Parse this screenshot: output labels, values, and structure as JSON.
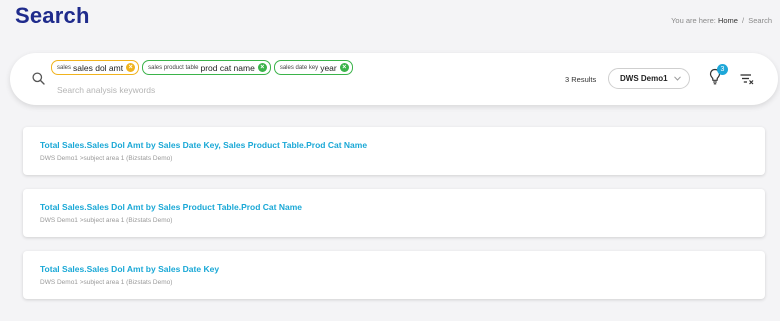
{
  "page": {
    "title": "Search"
  },
  "breadcrumb": {
    "prefix": "You are here:",
    "home": "Home",
    "separator": "/",
    "current": "Search"
  },
  "search": {
    "placeholder": "Search analysis keywords",
    "chips": [
      {
        "prefix": "sales",
        "main": "sales dol amt",
        "color": "#f0b31e"
      },
      {
        "prefix": "sales product table",
        "main": "prod cat name",
        "color": "#3bb34a"
      },
      {
        "prefix": "sales date key",
        "main": "year",
        "color": "#3bb34a"
      }
    ],
    "results_count": "3 Results",
    "dataset": "DWS Demo1",
    "suggestions_badge": "3"
  },
  "results": [
    {
      "title": "Total Sales.Sales Dol Amt by Sales Date Key, Sales Product Table.Prod Cat Name",
      "subtitle": "DWS Demo1 >subject area 1 (Bizstats Demo)"
    },
    {
      "title": "Total Sales.Sales Dol Amt by Sales Product Table.Prod Cat Name",
      "subtitle": "DWS Demo1 >subject area 1 (Bizstats Demo)"
    },
    {
      "title": "Total Sales.Sales Dol Amt by Sales Date Key",
      "subtitle": "DWS Demo1 >subject area 1 (Bizstats Demo)"
    }
  ],
  "colors": {
    "title": "#1f2b8c",
    "link": "#1aa8d6",
    "badge": "#1ea7d8"
  }
}
